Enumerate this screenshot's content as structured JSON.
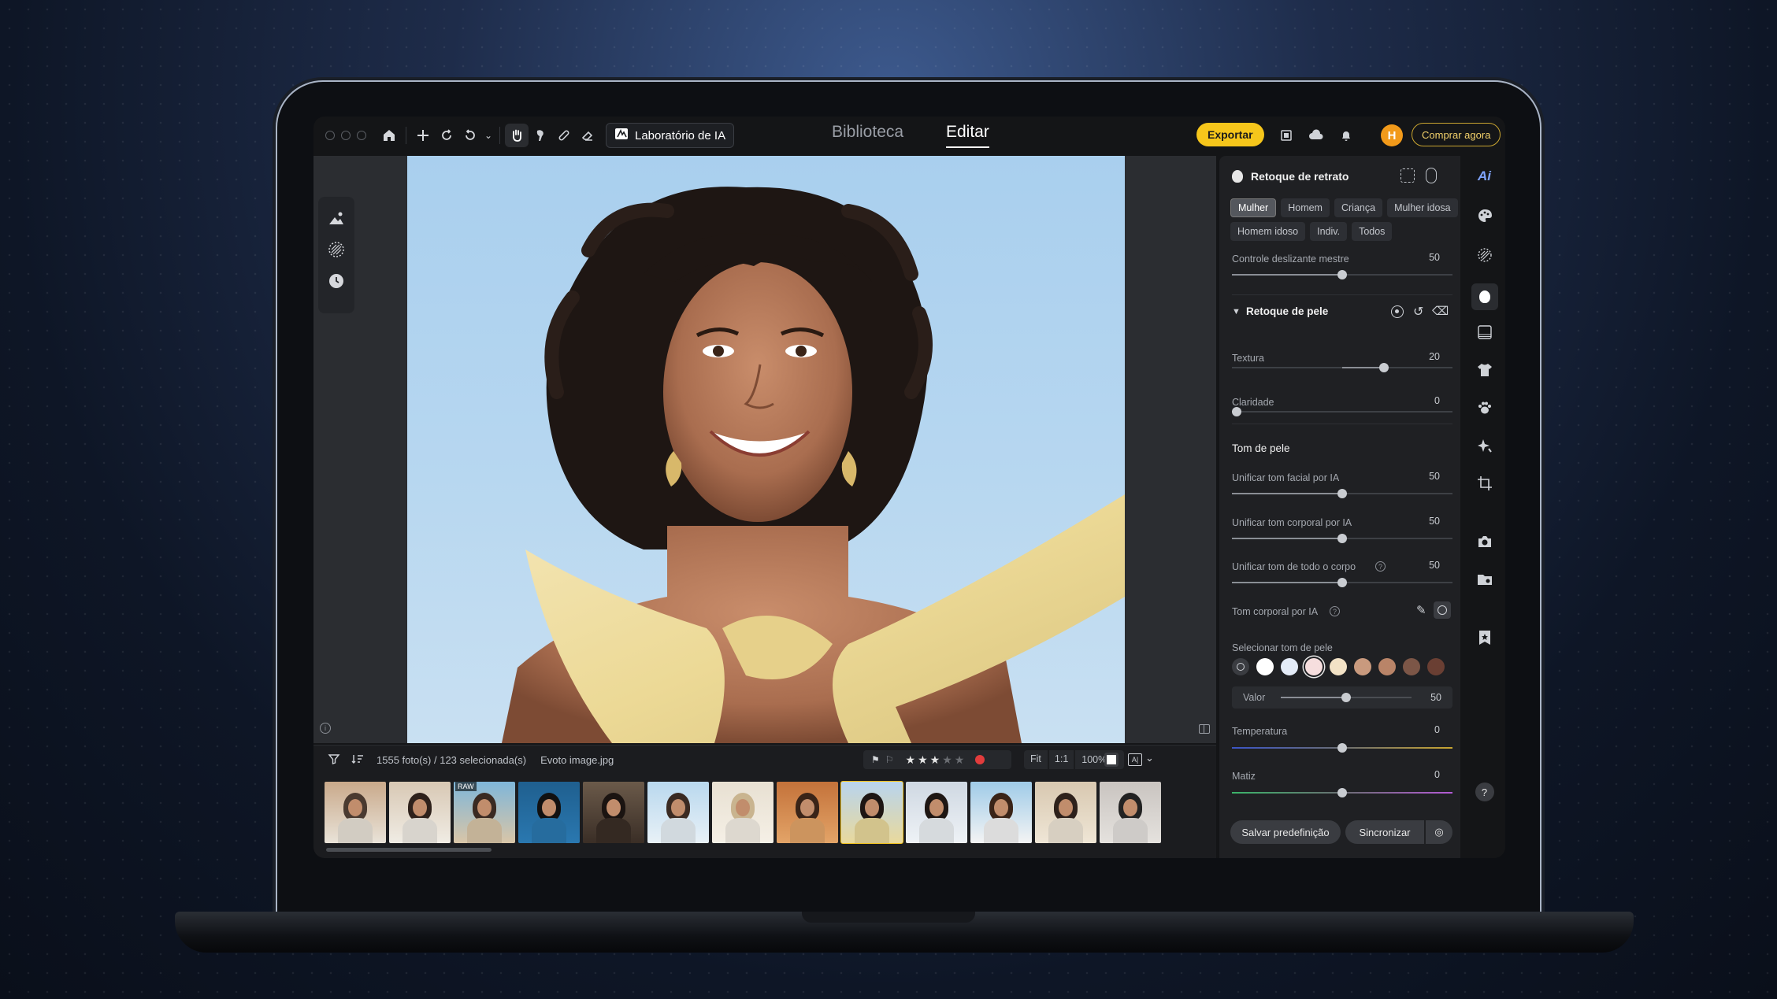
{
  "app": {
    "toolbar": {
      "ai_lab_label": "Laboratório de IA"
    },
    "nav": {
      "library": "Biblioteca",
      "edit": "Editar"
    },
    "actions": {
      "export": "Exportar",
      "buy": "Comprar agora",
      "avatar_initial": "H"
    },
    "filmstrip": {
      "count": "1555 foto(s) / 123 selecionada(s)",
      "filename": "Evoto image.jpg",
      "fit": "Fit",
      "one_to_one": "1:1",
      "zoom": "100%",
      "raw_badge": "RAW",
      "thumb_count": 13,
      "selected_index": 8
    },
    "panel": {
      "title": "Retoque de retrato",
      "chips": [
        "Mulher",
        "Homem",
        "Criança",
        "Mulher idosa",
        "Homem idoso",
        "Indiv.",
        "Todos"
      ],
      "active_chip": "Mulher",
      "master": {
        "label": "Controle deslizante mestre",
        "value": "50"
      },
      "skin": {
        "title": "Retoque de pele",
        "texture": {
          "label": "Textura",
          "value": "20"
        },
        "clarity": {
          "label": "Claridade",
          "value": "0"
        }
      },
      "tone": {
        "title": "Tom de pele",
        "face": {
          "label": "Unificar tom facial por IA",
          "value": "50"
        },
        "body": {
          "label": "Unificar tom corporal por IA",
          "value": "50"
        },
        "whole": {
          "label": "Unificar tom de todo o corpo",
          "value": "50"
        },
        "ai_body": {
          "label": "Tom corporal por IA"
        },
        "select": {
          "label": "Selecionar tom de pele"
        },
        "swatches": [
          "#ffffff",
          "#e4ecf8",
          "#f6dede",
          "#f2e2c6",
          "#c99a7e",
          "#b98468",
          "#7c5647",
          "#6a3f33"
        ],
        "selected_swatch": 2,
        "value": {
          "label": "Valor",
          "value": "50"
        },
        "temperature": {
          "label": "Temperatura",
          "value": "0"
        },
        "tint": {
          "label": "Matiz",
          "value": "0"
        }
      },
      "buttons": {
        "save": "Salvar predefinição",
        "sync": "Sincronizar"
      }
    },
    "help": "?"
  },
  "colors": {
    "accent": "#f6c61b",
    "selected_thumb": "#f0c21f"
  }
}
